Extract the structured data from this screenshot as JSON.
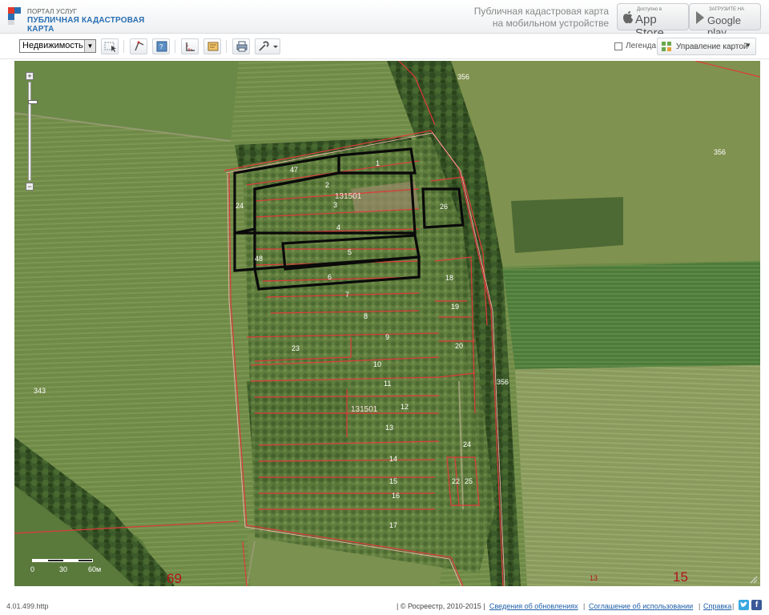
{
  "header": {
    "logo_small": "ПОРТАЛ УСЛУГ",
    "logo_big": "ПУБЛИЧНАЯ КАДАСТРОВАЯ КАРТА",
    "mobile_line1": "Публичная кадастровая карта",
    "mobile_line2": "на мобильном устройстве",
    "appstore_small": "Доступно в",
    "appstore_big": "App Store",
    "googleplay_small": "ЗАГРУЗИТЕ НА",
    "googleplay_big": "Google play"
  },
  "toolbar": {
    "layer_select_value": "Недвижимость",
    "legend_label": "Легенда",
    "legend_checked": false,
    "manage_map_label": "Управление картой",
    "tools": [
      "select-icon",
      "identify-icon",
      "search-icon",
      "measure-icon",
      "layers-icon",
      "print-icon",
      "settings-icon"
    ]
  },
  "map": {
    "parcel_labels": [
      "1",
      "2",
      "3",
      "4",
      "5",
      "6",
      "7",
      "8",
      "9",
      "10",
      "11",
      "12",
      "13",
      "14",
      "15",
      "16",
      "17",
      "18",
      "19",
      "20",
      "23",
      "24",
      "24",
      "26",
      "47",
      "48",
      "22",
      "25"
    ],
    "block_labels": [
      "131501",
      "131501"
    ],
    "area_labels": [
      "356",
      "356",
      "356",
      "343"
    ],
    "big_labels": [
      "69",
      "15",
      "13"
    ],
    "scale_labels": [
      "0",
      "30",
      "60м"
    ]
  },
  "footer": {
    "version": "4.01.499.http",
    "copyright": "| © Росреестр, 2010-2015 |",
    "link_updates": "Сведения об обновлениях",
    "link_terms": "Соглашение об использовании",
    "link_help": "Справка",
    "sep": "|"
  }
}
